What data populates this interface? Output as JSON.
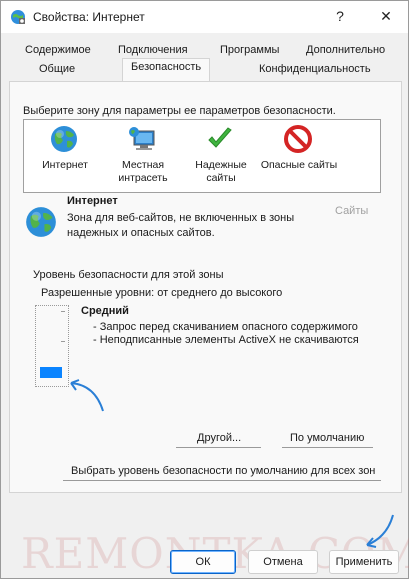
{
  "window": {
    "title": "Свойства: Интернет"
  },
  "titlebar": {
    "help": "?",
    "close": "✕"
  },
  "tabs": {
    "row1": [
      "Содержимое",
      "Подключения",
      "Программы",
      "Дополнительно"
    ],
    "row2": [
      "Общие",
      "Безопасность",
      "Конфиденциальность"
    ],
    "active": "Безопасность"
  },
  "security": {
    "zone_prompt": "Выберите зону для параметры ее параметров безопасности.",
    "zones": [
      {
        "label": "Интернет",
        "icon": "globe-icon"
      },
      {
        "label": "Местная интрасеть",
        "icon": "intranet-icon"
      },
      {
        "label": "Надежные сайты",
        "icon": "checkmark-icon"
      },
      {
        "label": "Опасные сайты",
        "icon": "forbidden-icon"
      }
    ],
    "selected_zone_title": "Интернет",
    "selected_zone_desc": "Зона для веб-сайтов, не включенных в зоны надежных и опасных сайтов.",
    "sites_button": "Сайты",
    "level_header": "Уровень безопасности для этой зоны",
    "allowed_levels": "Разрешенные уровни: от среднего до высокого",
    "level_name": "Средний",
    "level_bullets": [
      "- Запрос перед скачиванием опасного содержимого",
      "- Неподписанные элементы ActiveX не скачиваются"
    ],
    "slider_level": 0.0,
    "custom_button": "Другой...",
    "default_button": "По умолчанию",
    "reset_all_button": "Выбрать уровень безопасности по умолчанию для всех зон"
  },
  "footer": {
    "ok": "ОК",
    "cancel": "Отмена",
    "apply": "Применить"
  },
  "watermark": "REMONTKA.COM",
  "colors": {
    "accent": "#0a84ff",
    "annotation_arrow": "#2a7fd6"
  }
}
